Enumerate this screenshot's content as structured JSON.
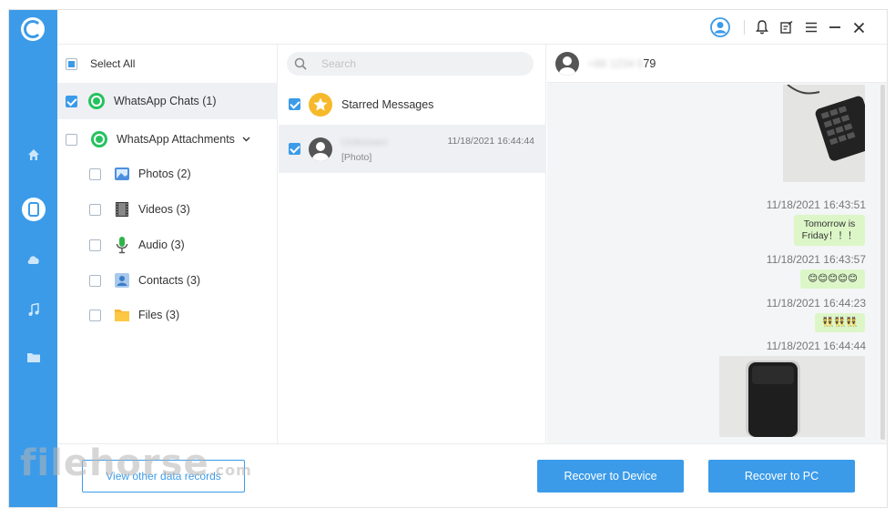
{
  "sidebar": {
    "nav": [
      "home-icon",
      "phone-icon",
      "cloud-icon",
      "music-icon",
      "folder-icon"
    ],
    "active": "phone-icon"
  },
  "topbar": {
    "icons": [
      "user-icon",
      "bell-icon",
      "feedback-icon",
      "menu-icon",
      "minimize-icon",
      "close-icon"
    ]
  },
  "categories": {
    "select_all": "Select All",
    "items": [
      {
        "label": "WhatsApp Chats (1)",
        "checked": true
      },
      {
        "label": "WhatsApp Attachments",
        "checked": false
      },
      {
        "label": "Photos (2)",
        "checked": false
      },
      {
        "label": "Videos (3)",
        "checked": false
      },
      {
        "label": "Audio (3)",
        "checked": false
      },
      {
        "label": "Contacts (3)",
        "checked": false
      },
      {
        "label": "Files (3)",
        "checked": false
      }
    ]
  },
  "chats": {
    "search_placeholder": "Search",
    "items": [
      {
        "name": "Starred Messages",
        "checked": true
      },
      {
        "name": "Unknown",
        "preview": "[Photo]",
        "time": "11/18/2021 16:44:44",
        "checked": true
      }
    ]
  },
  "conversation": {
    "contact_hidden": "+86 1234 5",
    "contact_suffix": "79",
    "messages": [
      {
        "time": "11/18/2021 16:43:51",
        "text": "Tomorrow is Friday！！！"
      },
      {
        "time": "11/18/2021 16:43:57",
        "text": "😊😊😊😊😊"
      },
      {
        "time": "11/18/2021 16:44:23",
        "text": "👯👯👯"
      },
      {
        "time": "11/18/2021 16:44:44",
        "text": ""
      }
    ]
  },
  "actions": {
    "view_other": "View other data records",
    "recover_device": "Recover to Device",
    "recover_pc": "Recover to PC"
  },
  "watermark": {
    "text": "filehorse",
    "suffix": ".com"
  },
  "colors": {
    "accent": "#3b9be9",
    "bubble": "#dcf6c8",
    "whatsapp": "#25c25f"
  }
}
